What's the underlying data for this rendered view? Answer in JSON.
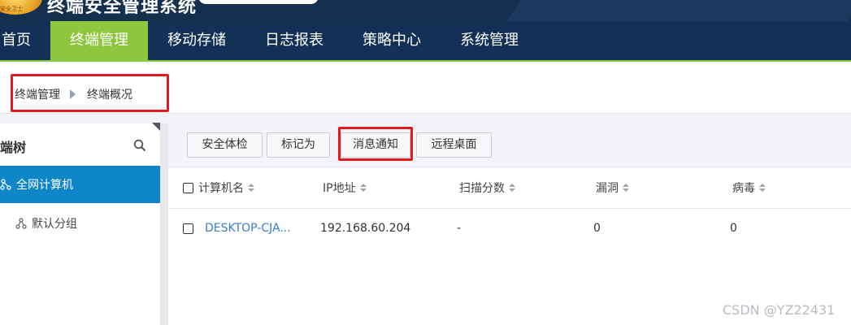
{
  "header": {
    "system_title": "终端安全管理系统",
    "badge_text": "安全卫士"
  },
  "nav": {
    "items": [
      {
        "label": "首页",
        "active": false
      },
      {
        "label": "终端管理",
        "active": true
      },
      {
        "label": "移动存储",
        "active": false
      },
      {
        "label": "日志报表",
        "active": false
      },
      {
        "label": "策略中心",
        "active": false
      },
      {
        "label": "系统管理",
        "active": false
      }
    ]
  },
  "breadcrumb": {
    "level1": "终端管理",
    "level2": "终端概况"
  },
  "sidebar": {
    "title": "端树",
    "items": [
      {
        "label": "全网计算机",
        "active": true
      },
      {
        "label": "默认分组",
        "active": false
      }
    ]
  },
  "toolbar": {
    "buttons": [
      "安全体检",
      "标记为",
      "消息通知",
      "远程桌面"
    ]
  },
  "table": {
    "columns": [
      "计算机名",
      "IP地址",
      "扫描分数",
      "漏洞",
      "病毒"
    ],
    "rows": [
      {
        "name": "DESKTOP-CJA...",
        "ip": "192.168.60.204",
        "score": "-",
        "vuln": "0",
        "virus": "0"
      }
    ]
  },
  "watermark": "CSDN @YZ22431",
  "colors": {
    "header_bg": "#15304f",
    "nav_bg": "#123154",
    "nav_active": "#8dc63f",
    "sidebar_active": "#0f86c7",
    "highlight_red": "#e4181f",
    "link_blue": "#3a7fc4"
  }
}
